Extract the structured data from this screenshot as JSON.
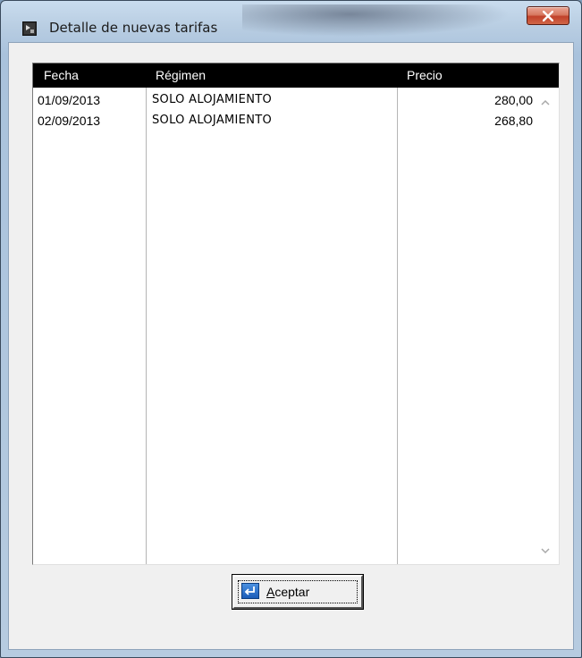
{
  "window": {
    "title": "Detalle de nuevas tarifas",
    "close_icon": "close-icon"
  },
  "grid": {
    "columns": [
      "Fecha",
      "Régimen",
      "Precio"
    ],
    "rows": [
      {
        "fecha": "01/09/2013",
        "regimen": "SOLO ALOJAMIENTO",
        "precio": "280,00"
      },
      {
        "fecha": "02/09/2013",
        "regimen": "SOLO ALOJAMIENTO",
        "precio": "268,80"
      }
    ]
  },
  "buttons": {
    "accept_first": "A",
    "accept_rest": "ceptar",
    "accept_icon": "enter-icon"
  },
  "colors": {
    "header_bg": "#000000",
    "header_fg": "#ffffff",
    "close_button": "#c1412a"
  }
}
